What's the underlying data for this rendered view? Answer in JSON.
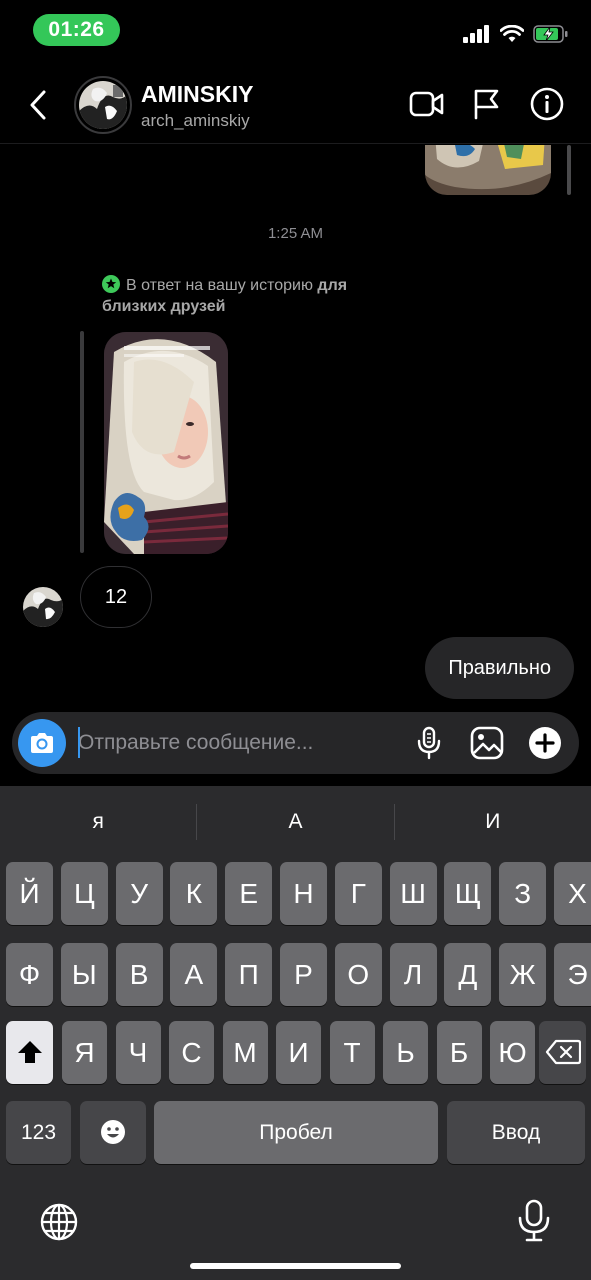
{
  "status_bar": {
    "time": "01:26"
  },
  "header": {
    "name": "AMINSKIY",
    "handle": "arch_aminskiy",
    "icons": [
      "back-icon",
      "video-call-icon",
      "flag-icon",
      "info-icon"
    ]
  },
  "chat": {
    "timestamp": "1:25 AM",
    "reply_label_prefix": "В ответ на вашу историю ",
    "reply_label_bold": "для близких друзей",
    "incoming_message": "12",
    "outgoing_message": "Правильно"
  },
  "composer": {
    "placeholder": "Отправьте сообщение...",
    "icons": [
      "camera-icon",
      "microphone-icon",
      "gallery-icon",
      "plus-icon"
    ]
  },
  "keyboard": {
    "suggestions": [
      "я",
      "А",
      "И"
    ],
    "row1": [
      "Й",
      "Ц",
      "У",
      "К",
      "Е",
      "Н",
      "Г",
      "Ш",
      "Щ",
      "З",
      "Х"
    ],
    "row2": [
      "Ф",
      "Ы",
      "В",
      "А",
      "П",
      "Р",
      "О",
      "Л",
      "Д",
      "Ж",
      "Э"
    ],
    "row3": [
      "Я",
      "Ч",
      "С",
      "М",
      "И",
      "Т",
      "Ь",
      "Б",
      "Ю"
    ],
    "numbers_label": "123",
    "space_label": "Пробел",
    "return_label": "Ввод"
  },
  "colors": {
    "accent_blue": "#3797f0",
    "time_pill_green": "#34c759",
    "close_friends_green": "#3ec95a",
    "bubble_out_bg": "#262628"
  }
}
